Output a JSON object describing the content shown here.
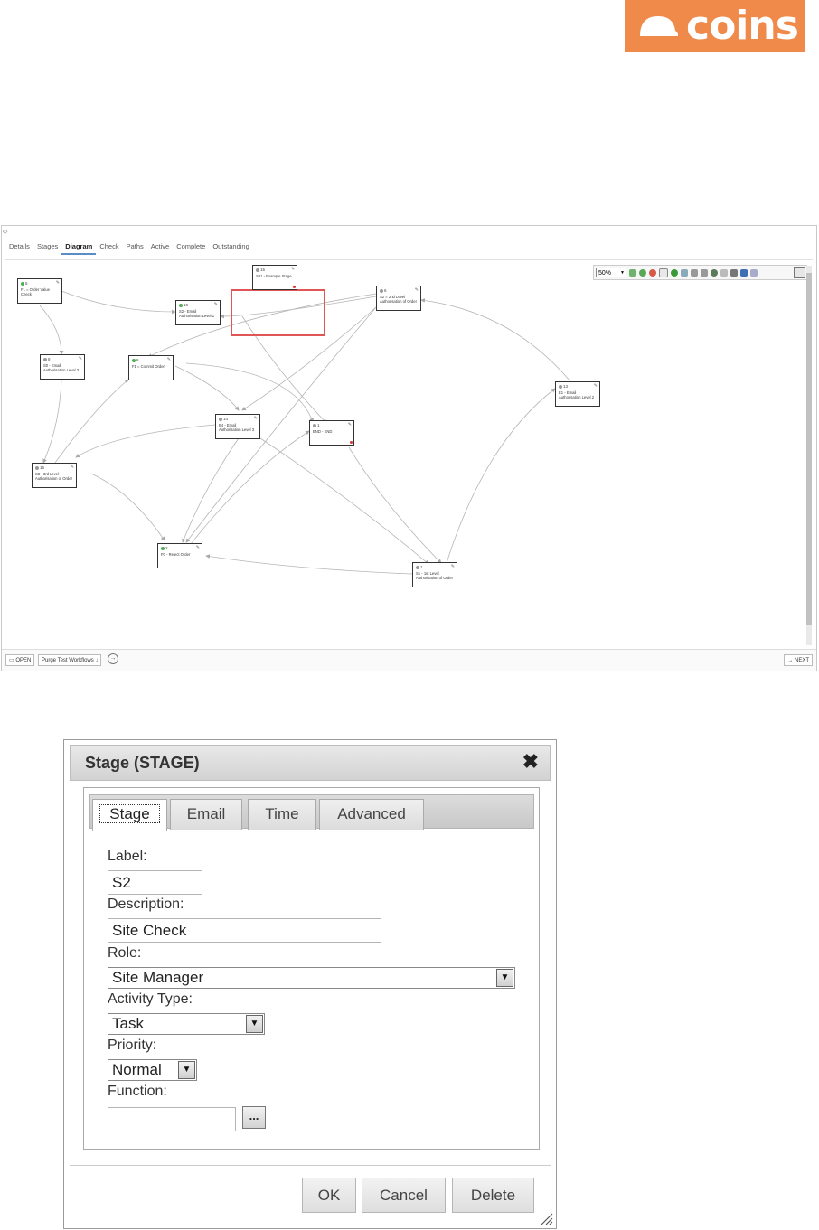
{
  "logo": {
    "text": "coins",
    "icon": "hardhat-icon",
    "color": "#ef8a4a"
  },
  "workflow": {
    "tabs": [
      "Details",
      "Stages",
      "Diagram",
      "Check",
      "Paths",
      "Active",
      "Complete",
      "Outstanding"
    ],
    "active_tab": "Diagram",
    "zoom": "50%",
    "nodes": {
      "n1": {
        "id": "5",
        "label": "F1 = Order Value Check"
      },
      "n2": {
        "id": "10",
        "label": "S2 - Email Authorisation Level 1"
      },
      "n3": {
        "id": "15",
        "label": "S01 - Example Stage"
      },
      "n4": {
        "id": "6",
        "label": "S2 = 2nd Level Authorisation of Order"
      },
      "n5": {
        "id": "8",
        "label": "S0 - Email Authorisation Level 3"
      },
      "n6": {
        "id": "6",
        "label": "F1 = Commit Order"
      },
      "n7": {
        "id": "13",
        "label": "E1 - Email Authorisation Level 2"
      },
      "n8": {
        "id": "14",
        "label": "E4 - Email Authorisation Level 3"
      },
      "n9": {
        "id": "1",
        "label": "END - END"
      },
      "n10": {
        "id": "16",
        "label": "S3 - 3rd Level Authorisation of Order"
      },
      "n11": {
        "id": "2",
        "label": "F0 - Reject Order"
      },
      "n12": {
        "id": "1",
        "label": "S1 - 1st Level Authorisation of Order"
      }
    },
    "bottom": {
      "open": "OPEN",
      "purge": "Purge Test Workflows",
      "next": "NEXT"
    }
  },
  "dialog": {
    "title": "Stage (STAGE)",
    "tabs": [
      "Stage",
      "Email",
      "Time",
      "Advanced"
    ],
    "fields": {
      "label_caption": "Label:",
      "label_value": "S2",
      "description_caption": "Description:",
      "description_value": "Site Check",
      "role_caption": "Role:",
      "role_value": "Site Manager",
      "activity_caption": "Activity Type:",
      "activity_value": "Task",
      "priority_caption": "Priority:",
      "priority_value": "Normal",
      "function_caption": "Function:",
      "function_value": ""
    },
    "lookup_button": "...",
    "buttons": {
      "ok": "OK",
      "cancel": "Cancel",
      "delete": "Delete"
    }
  }
}
